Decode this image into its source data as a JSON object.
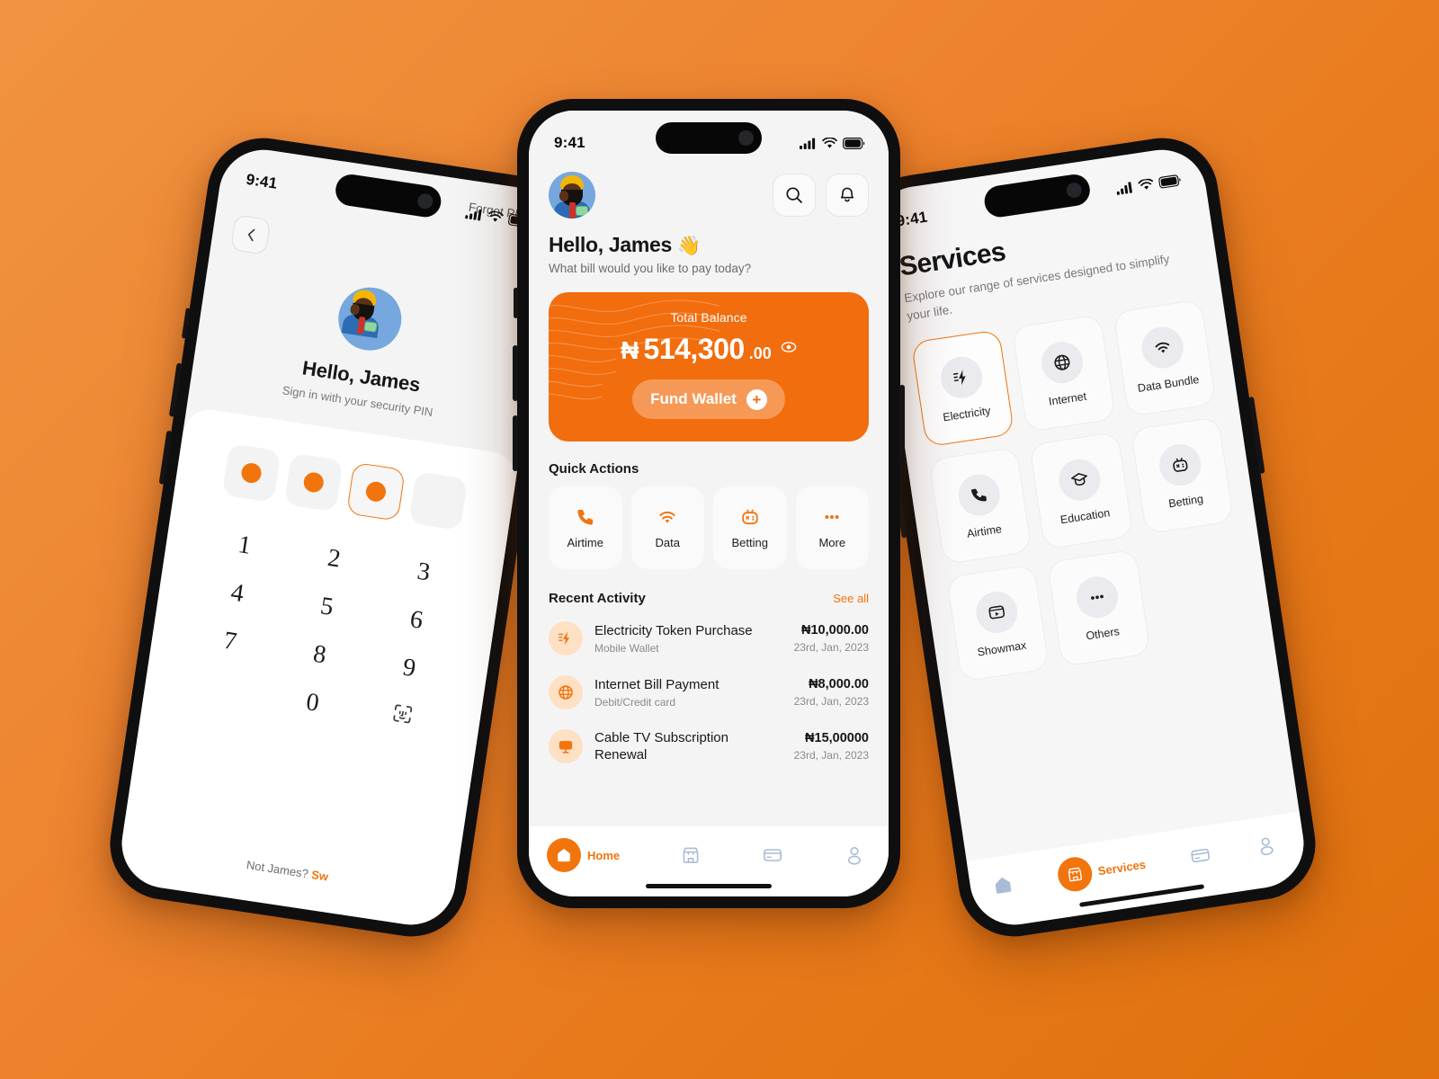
{
  "background": {
    "gradient_from": "#F09340",
    "gradient_to": "#E0710C"
  },
  "theme": {
    "accent": "#F2740D",
    "card": "#F26D0D",
    "nav_inactive": "#A9BCD6"
  },
  "pin_screen": {
    "status": {
      "time": "9:41"
    },
    "forgot_link": "Forgot PIN?",
    "back_icon": "chevron-left-icon",
    "avatar": "user-avatar",
    "greeting": "Hello, James",
    "subtitle": "Sign in with your security PIN",
    "pin_length": 4,
    "pin_filled": 3,
    "keypad": [
      "1",
      "2",
      "3",
      "4",
      "5",
      "6",
      "7",
      "8",
      "9",
      "",
      "0",
      "faceid-icon"
    ],
    "footer_prefix": "Not James? ",
    "footer_link": "Sw"
  },
  "home_screen": {
    "status": {
      "time": "9:41"
    },
    "avatar": "user-avatar",
    "search_icon": "search-icon",
    "bell_icon": "bell-icon",
    "greeting": "Hello, James",
    "wave": "👋",
    "subgreeting": "What bill would you like to pay today?",
    "balance": {
      "label": "Total Balance",
      "currency": "₦",
      "integer": "514,300",
      "decimal": ".00",
      "eye_icon": "eye-icon",
      "fund_label": "Fund Wallet",
      "fund_plus": "+"
    },
    "quick_actions_title": "Quick Actions",
    "quick_actions": [
      {
        "label": "Airtime",
        "icon": "phone-icon"
      },
      {
        "label": "Data",
        "icon": "wifi-icon"
      },
      {
        "label": "Betting",
        "icon": "game-controller-icon"
      },
      {
        "label": "More",
        "icon": "ellipsis-icon"
      }
    ],
    "activity_title": "Recent Activity",
    "see_all": "See all",
    "activity": [
      {
        "title": "Electricity Token Purchase",
        "sub": "Mobile Wallet",
        "amount": "₦10,000.00",
        "date": "23rd, Jan, 2023",
        "icon": "lightning-icon"
      },
      {
        "title": "Internet Bill Payment",
        "sub": "Debit/Credit card",
        "amount": "₦8,000.00",
        "date": "23rd, Jan, 2023",
        "icon": "globe-icon"
      },
      {
        "title": "Cable TV Subscription Renewal",
        "sub": "",
        "amount": "₦15,00000",
        "date": "23rd, Jan, 2023",
        "icon": "tv-icon"
      }
    ],
    "tabs": [
      {
        "label": "Home",
        "icon": "home-icon",
        "active": true
      },
      {
        "label": "",
        "icon": "store-icon",
        "active": false
      },
      {
        "label": "",
        "icon": "card-icon",
        "active": false
      },
      {
        "label": "",
        "icon": "person-icon",
        "active": false
      }
    ]
  },
  "services_screen": {
    "status": {
      "time": "9:41"
    },
    "title": "Services",
    "subtitle": "Explore our range of services designed to simplify your life.",
    "services": [
      {
        "label": "Electricity",
        "icon": "lightning-icon",
        "selected": true
      },
      {
        "label": "Internet",
        "icon": "globe-icon",
        "selected": false
      },
      {
        "label": "Data Bundle",
        "icon": "wifi-icon",
        "selected": false
      },
      {
        "label": "Airtime",
        "icon": "phone-icon",
        "selected": false
      },
      {
        "label": "Education",
        "icon": "graduation-cap-icon",
        "selected": false
      },
      {
        "label": "Betting",
        "icon": "game-controller-icon",
        "selected": false
      },
      {
        "label": "Showmax",
        "icon": "video-play-icon",
        "selected": false
      },
      {
        "label": "Others",
        "icon": "ellipsis-icon",
        "selected": false
      }
    ],
    "tabs": [
      {
        "label": "",
        "icon": "home-icon",
        "active": false
      },
      {
        "label": "Services",
        "icon": "store-icon",
        "active": true
      },
      {
        "label": "",
        "icon": "card-icon",
        "active": false
      },
      {
        "label": "",
        "icon": "person-icon",
        "active": false
      }
    ]
  }
}
